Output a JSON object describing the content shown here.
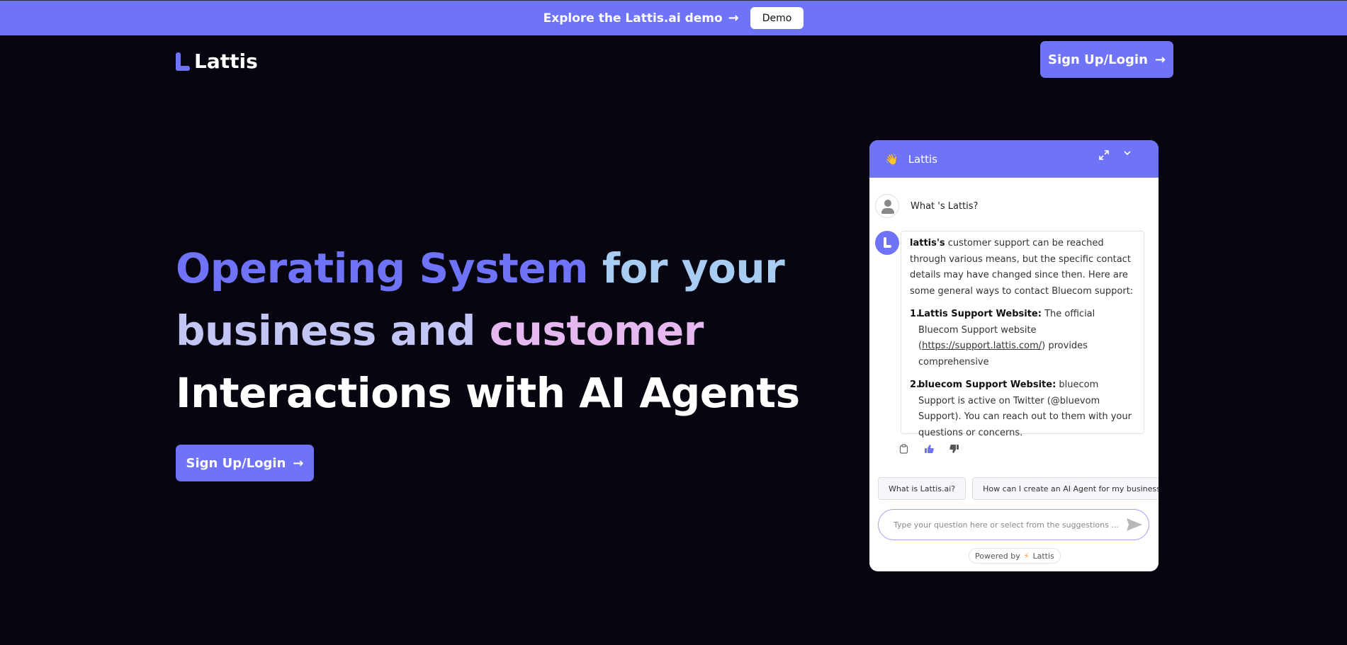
{
  "banner": {
    "text": "Explore the Lattis.ai demo",
    "arrow_icon": "arrow-right-icon",
    "demo_label": "Demo"
  },
  "header": {
    "logo_text": "Lattis",
    "cta_label": "Sign Up/Login"
  },
  "hero": {
    "line1_a": "Operating System",
    "line1_b": " for your",
    "line2_a": "business",
    "line2_b": " and",
    "line2_c": " customer",
    "line3": "Interactions with AI Agents",
    "cta_label": "Sign Up/Login"
  },
  "chat": {
    "title": "Lattis",
    "wave_icon": "👋",
    "user_question": "What 's Lattis?",
    "answer_lead_bold": "lattis's",
    "answer_lead": " customer support can be reached through various means, but the specific contact details may have changed since then. Here are some general ways to contact Bluecom support:",
    "items": [
      {
        "num": "1.",
        "title": "Lattis Support Website:",
        "text_before": " The official Bluecom Support website (",
        "link": "https://support.lattis.com/",
        "text_after": ") provides comprehensive"
      },
      {
        "num": "2.",
        "title": "bluecom Support Website:",
        "text_before": " bluecom Support is active on Twitter (@bluevom Support). You can reach out to them with your questions or concerns.",
        "link": "",
        "text_after": ""
      }
    ],
    "suggestions": [
      "What is Lattis.ai?",
      "How can I create an AI Agent for my business?"
    ],
    "input_placeholder": "Type your question here or select from the suggestions ...",
    "powered_by": "Powered by",
    "powered_brand": "Lattis"
  },
  "colors": {
    "accent": "#6f73f8",
    "background": "#07050f"
  }
}
